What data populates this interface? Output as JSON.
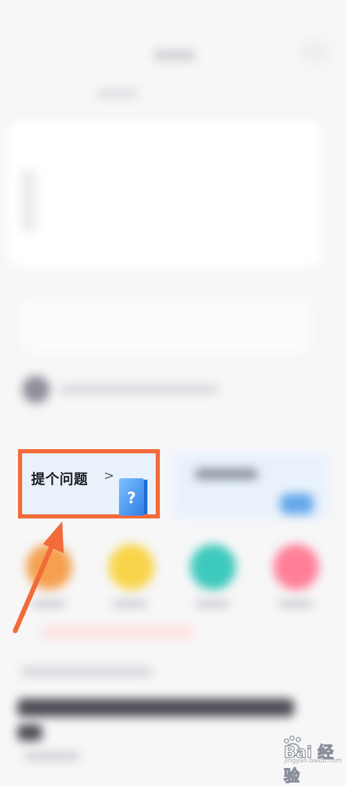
{
  "ask_card": {
    "label": "提个问题",
    "chevron": ">",
    "book_mark": "?",
    "border_color": "#f26b3a",
    "background": "#e9f1fb"
  },
  "annotation": {
    "arrow_color": "#f26b3a"
  },
  "shortcut_colors": [
    "#f5a04f",
    "#f9d44a",
    "#3ec9bd",
    "#ff7f99"
  ],
  "watermark": {
    "text": "Bai 经验",
    "sub": "jingyan.baidu.com"
  }
}
